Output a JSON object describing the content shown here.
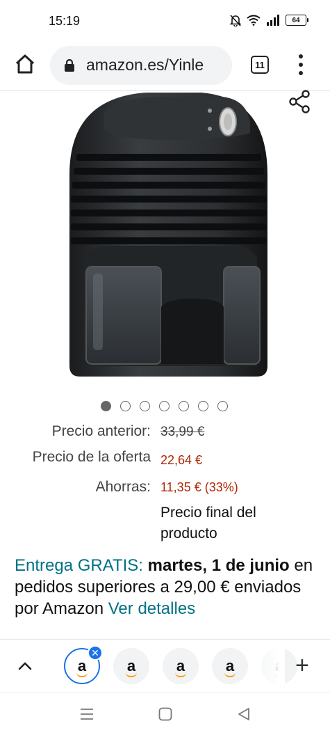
{
  "status_bar": {
    "time": "15:19",
    "battery": "64",
    "icons": [
      "mute-icon",
      "wifi-icon",
      "signal-icon",
      "battery-icon"
    ]
  },
  "browser": {
    "url": "amazon.es/Yinle",
    "tab_count": "11",
    "icons": [
      "home-icon",
      "lock-icon",
      "tab-switcher-icon",
      "menu-icon"
    ]
  },
  "product": {
    "image_alt_icon": "dehumidifier-image",
    "carousel": {
      "total": 7,
      "active_index": 0
    }
  },
  "pricing": {
    "previous_label": "Precio anterior:",
    "previous_value": "33,99 €",
    "deal_label": "Precio de la oferta",
    "deal_value": "22,64 €",
    "savings_label": "Ahorras:",
    "savings_value": "11,35 € (33%)",
    "final_note": "Precio final del producto"
  },
  "delivery": {
    "free_label": "Entrega GRATIS:",
    "date": "martes, 1 de junio",
    "condition": "en pedidos superiores a 29,00 € enviados por Amazon",
    "details_link": "Ver detalles"
  },
  "tab_strip": {
    "tabs": [
      {
        "logo": "a",
        "active": true
      },
      {
        "logo": "a",
        "active": false
      },
      {
        "logo": "a",
        "active": false
      },
      {
        "logo": "a",
        "active": false
      },
      {
        "logo": "a",
        "active": false
      }
    ],
    "close_symbol": "✕",
    "add_symbol": "+"
  },
  "colors": {
    "deal_red": "#b12704",
    "link_teal": "#007185",
    "active_tab_blue": "#1a73e8",
    "amazon_orange": "#ff9900"
  }
}
